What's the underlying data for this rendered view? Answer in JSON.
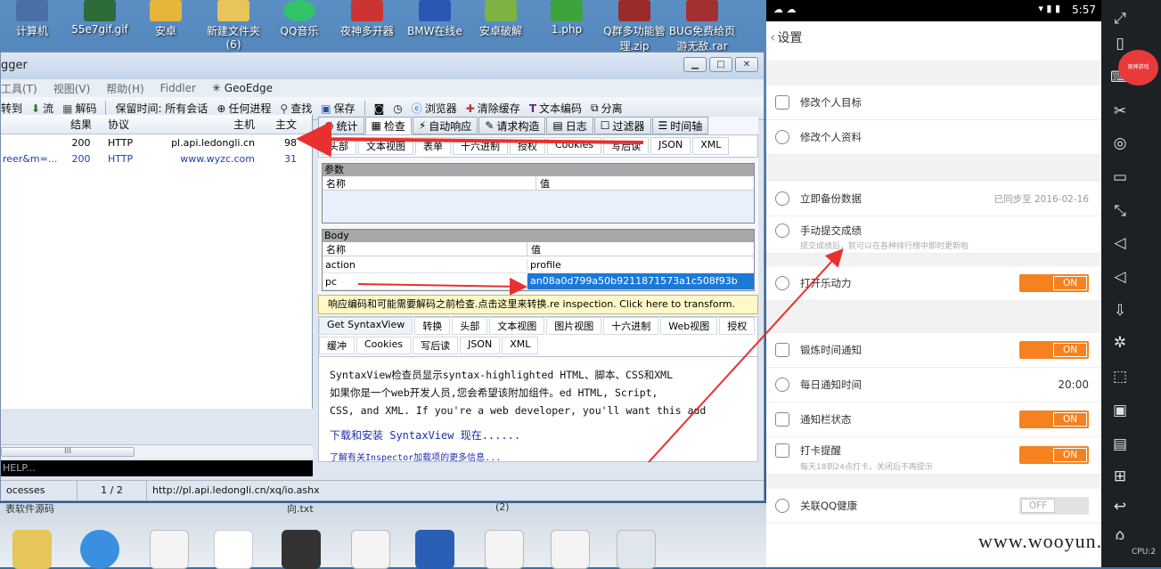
{
  "desktop": {
    "top_icons": [
      {
        "label": "计算机",
        "color": "#4a6fa8"
      },
      {
        "label": "55e7gif.gif",
        "color": "#2e6b3a"
      },
      {
        "label": "安卓",
        "color": "#e6b63a"
      },
      {
        "label": "新建文件夹 (6)",
        "color": "#e6c55a"
      },
      {
        "label": "QQ音乐",
        "color": "#31c26a"
      },
      {
        "label": "夜神多开器",
        "color": "#cc3333"
      },
      {
        "label": "BMW在线e",
        "color": "#2a57b3"
      },
      {
        "label": "安卓破解",
        "color": "#7cb342"
      },
      {
        "label": "1.php",
        "color": "#3da33d"
      },
      {
        "label": "Q群多功能管理.zip",
        "color": "#9b2a2a"
      },
      {
        "label": "BUG免费给页游无敌.rar",
        "color": "#a33030"
      }
    ],
    "bottom_labels": [
      "表软件源码",
      "向.txt",
      "(2)"
    ]
  },
  "fiddler": {
    "title": "gger",
    "menu": [
      "工具(T)",
      "视图(V)",
      "帮助(H)",
      "Fiddler",
      "GeoEdge"
    ],
    "toolbar": [
      "转到",
      "流",
      "解码",
      "保留时间: 所有会话",
      "任何进程",
      "查找",
      "保存",
      "浏览器",
      "清除缓存",
      "文本编码",
      "分离"
    ],
    "sessions": {
      "headers": [
        "结果",
        "协议",
        "主机",
        "主文"
      ],
      "rows": [
        {
          "url": "",
          "result": "200",
          "protocol": "HTTP",
          "host": "pl.api.ledongli.cn",
          "body": "98"
        },
        {
          "url": "reer&m=...",
          "result": "200",
          "protocol": "HTTP",
          "host": "www.wyzc.com",
          "body": "31"
        }
      ]
    },
    "inspector_tabs": [
      "统计",
      "检查",
      "自动响应",
      "请求构造",
      "日志",
      "过滤器",
      "时间轴"
    ],
    "request_tabs": [
      "头部",
      "文本视图",
      "表单",
      "十六进制",
      "授权",
      "Cookies",
      "写后读",
      "JSON",
      "XML"
    ],
    "params_title": "参数",
    "col_name": "名称",
    "col_value": "值",
    "body_title": "Body",
    "body_rows": [
      {
        "name": "action",
        "value": "profile"
      },
      {
        "name": "pc",
        "value": "an08a0d799a50b9211871573a1c508f93b"
      }
    ],
    "notice": "响应编码和可能需要解码之前检查.点击这里来转换.re inspection. Click here to transform.",
    "response_tabs": [
      "Get SyntaxView",
      "转换",
      "头部",
      "文本视图",
      "图片视图",
      "十六进制",
      "Web视图",
      "授权",
      "缓冲",
      "Cookies",
      "写后读",
      "JSON",
      "XML"
    ],
    "syntax_text": [
      "SyntaxView检查员显示syntax-highlighted  HTML、脚本、CSS和XML",
      "如果你是一个web开发人员,您会希望该附加组件。ed HTML, Script,",
      "CSS,  and XML.  If you're a web developer, you'll want this add"
    ],
    "download_link": "下载和安装  SyntaxView 现在......",
    "learn_more": "了解有关Inspector加载项的更多信息...",
    "quickexec": "HELP...",
    "status": {
      "processes": "ocesses",
      "count": "1 / 2",
      "url": "http://pl.api.ledongli.cn/xq/io.ashx"
    }
  },
  "phone": {
    "clock": "5:57",
    "title": "设置",
    "rows_top": [
      {
        "label": "修改个人目标"
      },
      {
        "label": "修改个人资料"
      }
    ],
    "backup_label": "立即备份数据",
    "backup_status": "已同步至  2016-02-16",
    "submit_label": "手动提交成绩",
    "submit_sub": "提交成绩后，就可以在各种排行榜中即时更新啦",
    "music_label": "打开乐动力",
    "toggle_on": "ON",
    "toggle_off": "OFF",
    "remind_label": "锻炼时间通知",
    "daily_label": "每日通知时间",
    "daily_value": "20:00",
    "notify_label": "通知栏状态",
    "card_label": "打卡提醒",
    "card_sub": "每天18到24点打卡，关闭后不再提示",
    "qq_label": "关联QQ健康"
  },
  "emulator": {
    "badge": "夜神游戏",
    "cpu": "CPU:2"
  },
  "watermark": "www.wooyun.org",
  "colors": {
    "accent_orange": "#f5821f",
    "selection_blue": "#1c79d8",
    "arrow_red": "#e8302f",
    "notice_yellow": "#fff9c6"
  }
}
